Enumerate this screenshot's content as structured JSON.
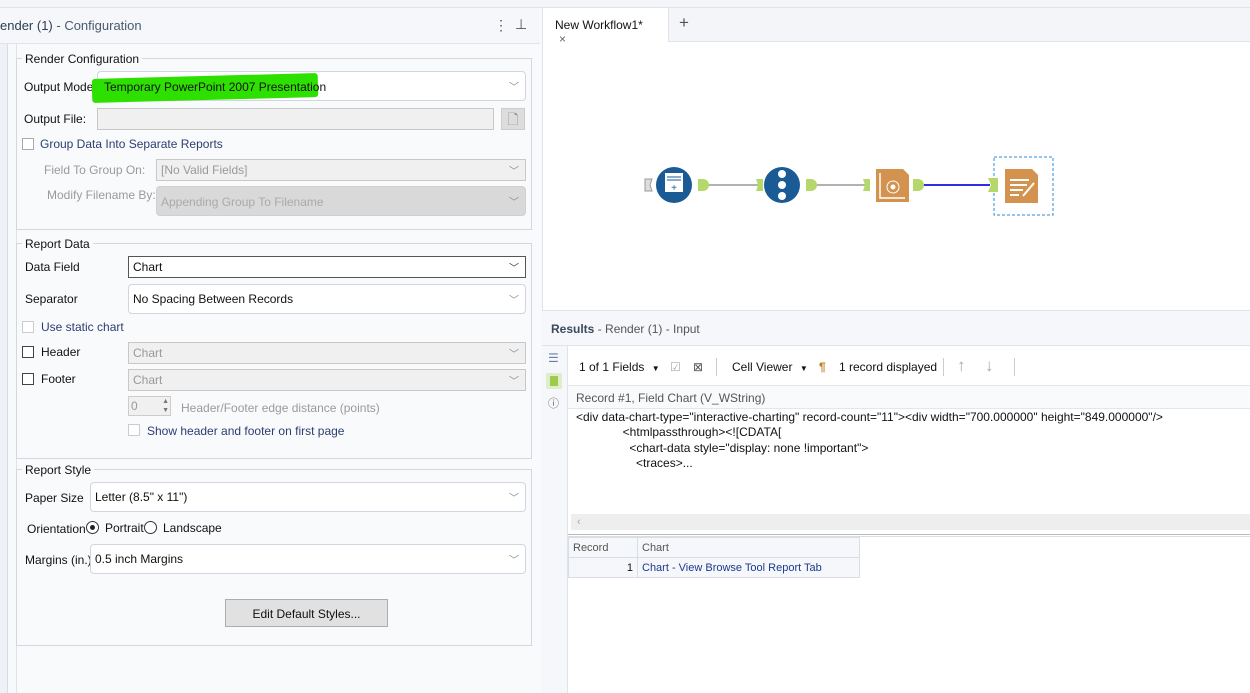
{
  "config_panel": {
    "title": "ender (1)",
    "subtitle": "- Configuration",
    "render_configuration": {
      "legend": "Render Configuration",
      "output_mode_label": "Output Mode:",
      "output_mode_value": "Temporary PowerPoint 2007 Presentation",
      "output_file_label": "Output File:",
      "output_file_value": "",
      "group_data_label": "Group Data Into Separate Reports",
      "field_to_group_label": "Field To Group On:",
      "field_to_group_value": "[No Valid Fields]",
      "modify_filename_label": "Modify Filename By:",
      "modify_filename_value": "Appending Group To Filename"
    },
    "report_data": {
      "legend": "Report Data",
      "data_field_label": "Data Field",
      "data_field_value": "Chart",
      "separator_label": "Separator",
      "separator_value": "No Spacing Between Records",
      "static_chart_label": "Use static chart",
      "header_label": "Header",
      "header_value": "Chart",
      "footer_label": "Footer",
      "footer_value": "Chart",
      "edge_distance_value": "0",
      "edge_distance_label": "Header/Footer edge distance (points)",
      "show_first_page_label": "Show header and footer on first page"
    },
    "report_style": {
      "legend": "Report Style",
      "paper_size_label": "Paper Size",
      "paper_size_value": "Letter (8.5\" x 11\")",
      "orientation_label": "Orientation",
      "portrait_label": "Portrait",
      "landscape_label": "Landscape",
      "margins_label": "Margins (in.)",
      "margins_value": "0.5 inch Margins",
      "edit_styles_button": "Edit Default Styles..."
    }
  },
  "workflow": {
    "tab_label": "New Workflow1*",
    "close_glyph": "×",
    "add_tab_glyph": "+",
    "tool_icons": [
      "input-data-tool-icon",
      "record-id-tool-icon",
      "interactive-chart-tool-icon",
      "render-tool-icon"
    ],
    "colors": {
      "blue_tool": "#1a5b96",
      "orange_tool": "#d4924f",
      "connector": "#b5d86a",
      "selected_connection": "#2d2ee8"
    }
  },
  "results": {
    "title": "Results",
    "subtitle": "- Render (1) - Input",
    "fields_selector": "1 of 1 Fields",
    "cell_viewer": "Cell Viewer",
    "records_displayed": "1 record displayed",
    "record_header": "Record #1, Field Chart (V_WString)",
    "cell_content": "<div data-chart-type=\"interactive-charting\" record-count=\"11\"><div width=\"700.000000\" height=\"849.000000\"/>\n              <htmlpassthrough><![CDATA[\n                <chart-data style=\"display: none !important\">\n                  <traces>...",
    "table": {
      "columns": [
        "Record",
        "Chart"
      ],
      "rows": [
        [
          "1",
          "Chart - View Browse Tool Report Tab"
        ]
      ]
    }
  }
}
